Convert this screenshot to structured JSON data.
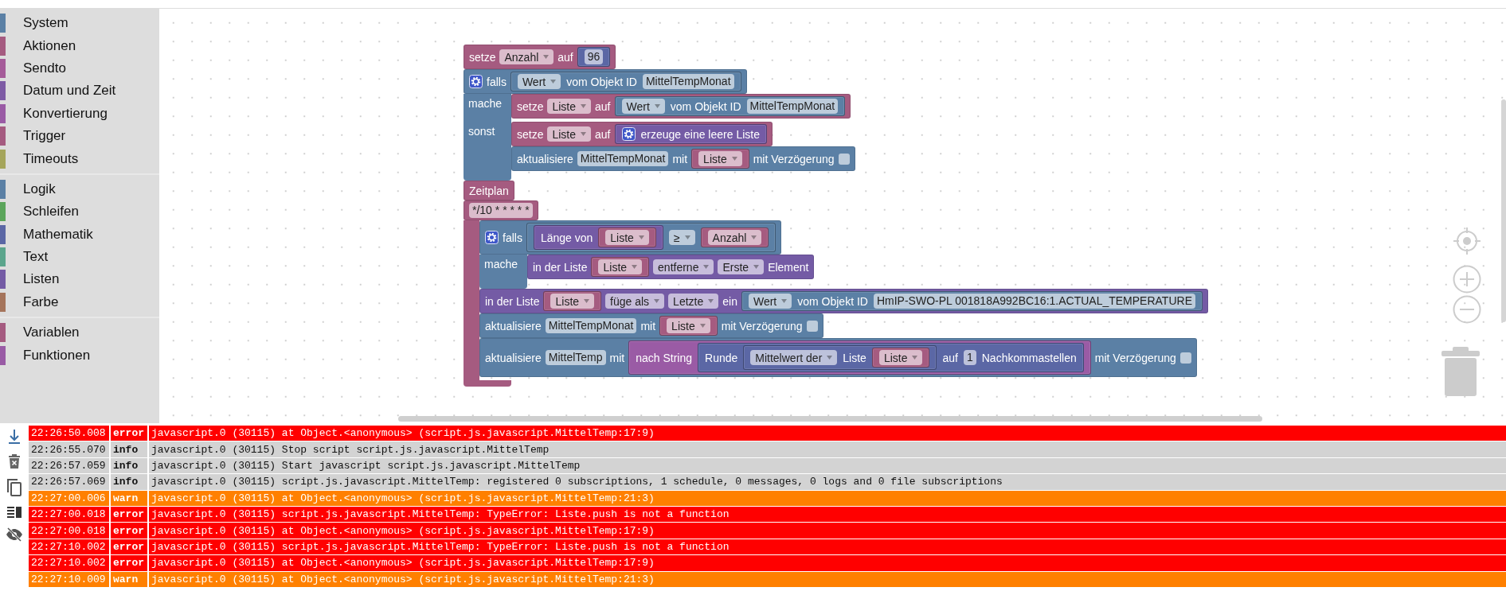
{
  "sidebar": {
    "groups": [
      [
        {
          "label": "System",
          "color": "#5b80a5"
        },
        {
          "label": "Aktionen",
          "color": "#a55b80"
        },
        {
          "label": "Sendto",
          "color": "#a55b99"
        },
        {
          "label": "Datum und Zeit",
          "color": "#7e5ba5"
        },
        {
          "label": "Konvertierung",
          "color": "#9a5ba5"
        },
        {
          "label": "Trigger",
          "color": "#a55b80"
        },
        {
          "label": "Timeouts",
          "color": "#a5a55b"
        }
      ],
      [
        {
          "label": "Logik",
          "color": "#5b80a5"
        },
        {
          "label": "Schleifen",
          "color": "#5ba55b"
        },
        {
          "label": "Mathematik",
          "color": "#5b67a5"
        },
        {
          "label": "Text",
          "color": "#5ba58c"
        },
        {
          "label": "Listen",
          "color": "#745ba5"
        },
        {
          "label": "Farbe",
          "color": "#a5745b"
        }
      ],
      [
        {
          "label": "Variablen",
          "color": "#a55b80"
        },
        {
          "label": "Funktionen",
          "color": "#995ba5"
        }
      ]
    ]
  },
  "workspace": {
    "blocks": [
      {
        "color": "#a55b80",
        "rows": [
          {
            "parts": [
              {
                "kind": "label",
                "text": "setze"
              },
              {
                "kind": "dropdown",
                "text": "Anzahl"
              },
              {
                "kind": "label",
                "text": "auf"
              },
              {
                "kind": "input",
                "block": {
                  "color": "#5b67a5",
                  "parts": [
                    {
                      "kind": "field",
                      "text": "96"
                    }
                  ]
                }
              }
            ]
          }
        ]
      },
      {
        "color": "#5b80a5",
        "rows": [
          {
            "parts": [
              {
                "kind": "gear"
              },
              {
                "kind": "label",
                "text": "falls"
              },
              {
                "kind": "input",
                "block": {
                  "color": "#5b80a5",
                  "parts": [
                    {
                      "kind": "dropdown",
                      "text": "Wert"
                    },
                    {
                      "kind": "label",
                      "text": "vom Objekt ID"
                    },
                    {
                      "kind": "field",
                      "text": "MittelTempMonat"
                    }
                  ]
                }
              }
            ]
          },
          {
            "parts": [
              {
                "kind": "label",
                "text": "mache"
              }
            ],
            "body": [
              {
                "color": "#a55b80",
                "rows": [
                  {
                    "parts": [
                      {
                        "kind": "label",
                        "text": "setze"
                      },
                      {
                        "kind": "dropdown",
                        "text": "Liste"
                      },
                      {
                        "kind": "label",
                        "text": "auf"
                      },
                      {
                        "kind": "input",
                        "block": {
                          "color": "#5b80a5",
                          "parts": [
                            {
                              "kind": "dropdown",
                              "text": "Wert"
                            },
                            {
                              "kind": "label",
                              "text": "vom Objekt ID"
                            },
                            {
                              "kind": "field",
                              "text": "MittelTempMonat"
                            }
                          ]
                        }
                      }
                    ]
                  }
                ]
              }
            ]
          },
          {
            "parts": [
              {
                "kind": "label",
                "text": "sonst"
              }
            ],
            "body": [
              {
                "color": "#a55b80",
                "rows": [
                  {
                    "parts": [
                      {
                        "kind": "label",
                        "text": "setze"
                      },
                      {
                        "kind": "dropdown",
                        "text": "Liste"
                      },
                      {
                        "kind": "label",
                        "text": "auf"
                      },
                      {
                        "kind": "input",
                        "block": {
                          "color": "#745ba5",
                          "parts": [
                            {
                              "kind": "gear"
                            },
                            {
                              "kind": "label",
                              "text": "erzeuge eine leere Liste"
                            }
                          ]
                        }
                      }
                    ]
                  }
                ]
              },
              {
                "color": "#5b80a5",
                "rows": [
                  {
                    "parts": [
                      {
                        "kind": "label",
                        "text": "aktualisiere"
                      },
                      {
                        "kind": "field",
                        "text": "MittelTempMonat"
                      },
                      {
                        "kind": "label",
                        "text": "mit"
                      },
                      {
                        "kind": "input",
                        "block": {
                          "color": "#a55b80",
                          "parts": [
                            {
                              "kind": "dropdown",
                              "text": "Liste"
                            }
                          ]
                        }
                      },
                      {
                        "kind": "label",
                        "text": "mit Verzögerung"
                      },
                      {
                        "kind": "checkbox",
                        "checked": false
                      }
                    ]
                  }
                ]
              }
            ]
          }
        ]
      },
      {
        "color": "#a55b80",
        "rows": [
          {
            "parts": [
              {
                "kind": "label",
                "text": "Zeitplan"
              }
            ]
          },
          {
            "parts": [
              {
                "kind": "field",
                "text": "*/10 * * * * *"
              }
            ]
          },
          {
            "parts": [],
            "body": [
              {
                "color": "#5b80a5",
                "rows": [
                  {
                    "parts": [
                      {
                        "kind": "gear"
                      },
                      {
                        "kind": "label",
                        "text": "falls"
                      },
                      {
                        "kind": "input",
                        "block": {
                          "color": "#5b80a5",
                          "parts": [
                            {
                              "kind": "input",
                              "block": {
                                "color": "#745ba5",
                                "parts": [
                                  {
                                    "kind": "label",
                                    "text": "Länge von"
                                  },
                                  {
                                    "kind": "input",
                                    "block": {
                                      "color": "#a55b80",
                                      "parts": [
                                        {
                                          "kind": "dropdown",
                                          "text": "Liste"
                                        }
                                      ]
                                    }
                                  }
                                ]
                              }
                            },
                            {
                              "kind": "dropdown",
                              "text": "≥"
                            },
                            {
                              "kind": "input",
                              "block": {
                                "color": "#a55b80",
                                "parts": [
                                  {
                                    "kind": "dropdown",
                                    "text": "Anzahl"
                                  }
                                ]
                              }
                            }
                          ]
                        }
                      }
                    ]
                  },
                  {
                    "parts": [
                      {
                        "kind": "label",
                        "text": "mache"
                      }
                    ],
                    "body": [
                      {
                        "color": "#745ba5",
                        "rows": [
                          {
                            "parts": [
                              {
                                "kind": "label",
                                "text": "in der Liste"
                              },
                              {
                                "kind": "input",
                                "block": {
                                  "color": "#a55b80",
                                  "parts": [
                                    {
                                      "kind": "dropdown",
                                      "text": "Liste"
                                    }
                                  ]
                                }
                              },
                              {
                                "kind": "dropdown",
                                "text": "entferne"
                              },
                              {
                                "kind": "dropdown",
                                "text": "Erste"
                              },
                              {
                                "kind": "label",
                                "text": "Element"
                              }
                            ]
                          }
                        ]
                      }
                    ]
                  }
                ]
              },
              {
                "color": "#745ba5",
                "rows": [
                  {
                    "parts": [
                      {
                        "kind": "label",
                        "text": "in der Liste"
                      },
                      {
                        "kind": "input",
                        "block": {
                          "color": "#a55b80",
                          "parts": [
                            {
                              "kind": "dropdown",
                              "text": "Liste"
                            }
                          ]
                        }
                      },
                      {
                        "kind": "dropdown",
                        "text": "füge als"
                      },
                      {
                        "kind": "dropdown",
                        "text": "Letzte"
                      },
                      {
                        "kind": "label",
                        "text": "ein"
                      },
                      {
                        "kind": "input",
                        "block": {
                          "color": "#5b80a5",
                          "parts": [
                            {
                              "kind": "dropdown",
                              "text": "Wert"
                            },
                            {
                              "kind": "label",
                              "text": "vom Objekt ID"
                            },
                            {
                              "kind": "field",
                              "text": "HmIP-SWO-PL 001818A992BC16:1.ACTUAL_TEMPERATURE"
                            }
                          ]
                        }
                      }
                    ]
                  }
                ]
              },
              {
                "color": "#5b80a5",
                "rows": [
                  {
                    "parts": [
                      {
                        "kind": "label",
                        "text": "aktualisiere"
                      },
                      {
                        "kind": "field",
                        "text": "MittelTempMonat"
                      },
                      {
                        "kind": "label",
                        "text": "mit"
                      },
                      {
                        "kind": "input",
                        "block": {
                          "color": "#a55b80",
                          "parts": [
                            {
                              "kind": "dropdown",
                              "text": "Liste"
                            }
                          ]
                        }
                      },
                      {
                        "kind": "label",
                        "text": "mit Verzögerung"
                      },
                      {
                        "kind": "checkbox",
                        "checked": false
                      }
                    ]
                  }
                ]
              },
              {
                "color": "#5b80a5",
                "rows": [
                  {
                    "parts": [
                      {
                        "kind": "label",
                        "text": "aktualisiere"
                      },
                      {
                        "kind": "field",
                        "text": "MittelTemp"
                      },
                      {
                        "kind": "label",
                        "text": "mit"
                      },
                      {
                        "kind": "input",
                        "block": {
                          "color": "#9a5ba5",
                          "parts": [
                            {
                              "kind": "label",
                              "text": "nach String"
                            },
                            {
                              "kind": "input",
                              "block": {
                                "color": "#5b67a5",
                                "parts": [
                                  {
                                    "kind": "label",
                                    "text": "Runde"
                                  },
                                  {
                                    "kind": "input",
                                    "block": {
                                      "color": "#5b67a5",
                                      "parts": [
                                        {
                                          "kind": "dropdown",
                                          "text": "Mittelwert der"
                                        },
                                        {
                                          "kind": "label",
                                          "text": "Liste"
                                        },
                                        {
                                          "kind": "input",
                                          "block": {
                                            "color": "#a55b80",
                                            "parts": [
                                              {
                                                "kind": "dropdown",
                                                "text": "Liste"
                                              }
                                            ]
                                          }
                                        }
                                      ]
                                    }
                                  },
                                  {
                                    "kind": "label",
                                    "text": "auf"
                                  },
                                  {
                                    "kind": "field",
                                    "text": "1"
                                  },
                                  {
                                    "kind": "label",
                                    "text": "Nachkommastellen"
                                  }
                                ]
                              }
                            }
                          ]
                        }
                      },
                      {
                        "kind": "label",
                        "text": "mit Verzögerung"
                      },
                      {
                        "kind": "checkbox",
                        "checked": false
                      }
                    ]
                  }
                ]
              }
            ]
          }
        ]
      }
    ]
  },
  "log": {
    "rows": [
      {
        "kind": "error",
        "time": "22:26:50.008",
        "level": "error",
        "message": "javascript.0 (30115) at Object.<anonymous> (script.js.javascript.MittelTemp:17:9)"
      },
      {
        "kind": "info",
        "time": "22:26:55.070",
        "level": "info",
        "message": "javascript.0 (30115) Stop script script.js.javascript.MittelTemp"
      },
      {
        "kind": "info",
        "time": "22:26:57.059",
        "level": "info",
        "message": "javascript.0 (30115) Start javascript script.js.javascript.MittelTemp"
      },
      {
        "kind": "info",
        "time": "22:26:57.069",
        "level": "info",
        "message": "javascript.0 (30115) script.js.javascript.MittelTemp: registered 0 subscriptions, 1 schedule, 0 messages, 0 logs and 0 file subscriptions"
      },
      {
        "kind": "warn",
        "time": "22:27:00.006",
        "level": "warn",
        "message": "javascript.0 (30115) at Object.<anonymous> (script.js.javascript.MittelTemp:21:3)"
      },
      {
        "kind": "error",
        "time": "22:27:00.018",
        "level": "error",
        "message": "javascript.0 (30115) script.js.javascript.MittelTemp: TypeError: Liste.push is not a function"
      },
      {
        "kind": "error",
        "time": "22:27:00.018",
        "level": "error",
        "message": "javascript.0 (30115) at Object.<anonymous> (script.js.javascript.MittelTemp:17:9)"
      },
      {
        "kind": "error",
        "time": "22:27:10.002",
        "level": "error",
        "message": "javascript.0 (30115) script.js.javascript.MittelTemp: TypeError: Liste.push is not a function"
      },
      {
        "kind": "error",
        "time": "22:27:10.002",
        "level": "error",
        "message": "javascript.0 (30115) at Object.<anonymous> (script.js.javascript.MittelTemp:17:9)"
      },
      {
        "kind": "warn",
        "time": "22:27:10.009",
        "level": "warn",
        "message": "javascript.0 (30115) at Object.<anonymous> (script.js.javascript.MittelTemp:21:3)"
      }
    ]
  }
}
